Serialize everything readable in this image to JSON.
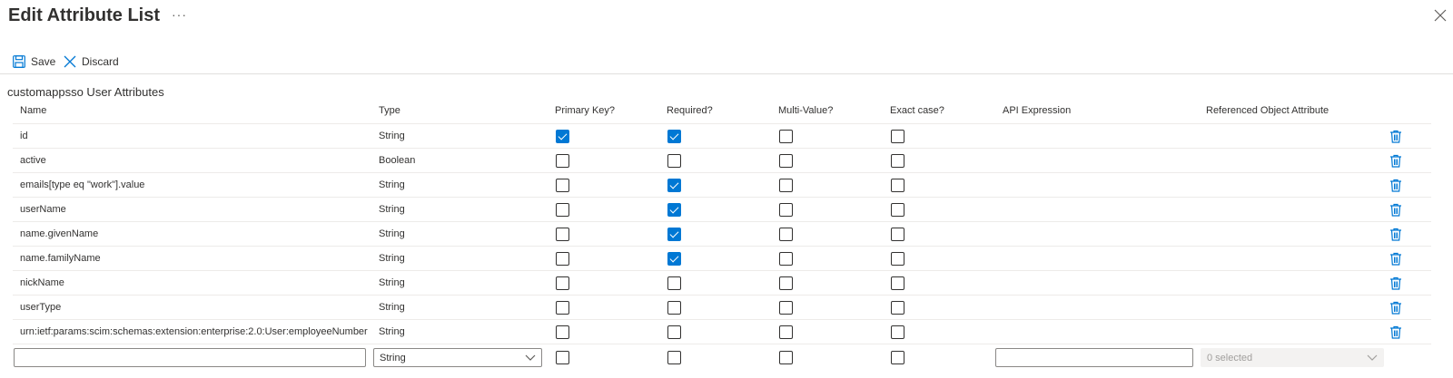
{
  "header": {
    "title": "Edit Attribute List",
    "more": "···"
  },
  "toolbar": {
    "save_label": "Save",
    "discard_label": "Discard"
  },
  "section_title": "customappsso User Attributes",
  "columns": {
    "name": "Name",
    "type": "Type",
    "primary_key": "Primary Key?",
    "required": "Required?",
    "multi_value": "Multi-Value?",
    "exact_case": "Exact case?",
    "api_expression": "API Expression",
    "referenced": "Referenced Object Attribute"
  },
  "rows": [
    {
      "name": "id",
      "type": "String",
      "primary_key": true,
      "required": true,
      "multi_value": false,
      "exact_case": false
    },
    {
      "name": "active",
      "type": "Boolean",
      "primary_key": false,
      "required": false,
      "multi_value": false,
      "exact_case": false
    },
    {
      "name": "emails[type eq \"work\"].value",
      "type": "String",
      "primary_key": false,
      "required": true,
      "multi_value": false,
      "exact_case": false
    },
    {
      "name": "userName",
      "type": "String",
      "primary_key": false,
      "required": true,
      "multi_value": false,
      "exact_case": false
    },
    {
      "name": "name.givenName",
      "type": "String",
      "primary_key": false,
      "required": true,
      "multi_value": false,
      "exact_case": false
    },
    {
      "name": "name.familyName",
      "type": "String",
      "primary_key": false,
      "required": true,
      "multi_value": false,
      "exact_case": false
    },
    {
      "name": "nickName",
      "type": "String",
      "primary_key": false,
      "required": false,
      "multi_value": false,
      "exact_case": false
    },
    {
      "name": "userType",
      "type": "String",
      "primary_key": false,
      "required": false,
      "multi_value": false,
      "exact_case": false
    },
    {
      "name": "urn:ietf:params:scim:schemas:extension:enterprise:2.0:User:employeeNumber",
      "type": "String",
      "primary_key": false,
      "required": false,
      "multi_value": false,
      "exact_case": false
    }
  ],
  "new_row": {
    "name_value": "",
    "type_value": "String",
    "api_expression_value": "",
    "referenced_value": "0 selected"
  },
  "colors": {
    "accent": "#0078d4",
    "text": "#323130",
    "border": "#edebe9"
  },
  "icons": {
    "save": "save-icon",
    "discard": "close-icon",
    "delete": "trash-icon",
    "dropdown": "chevron-down-icon"
  }
}
